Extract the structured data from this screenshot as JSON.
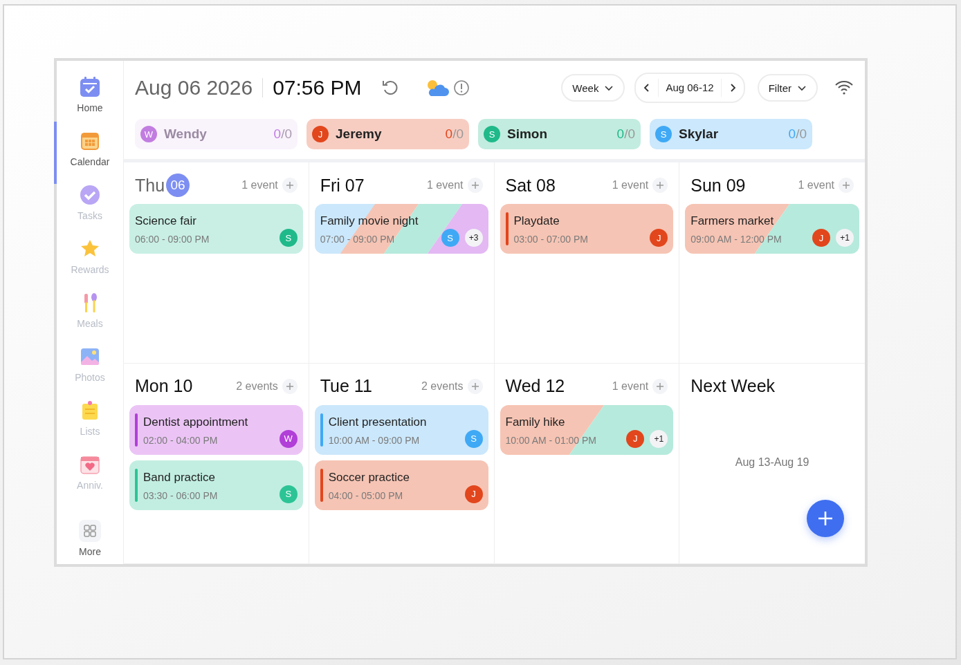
{
  "sidebar": {
    "items": [
      {
        "label": "Home",
        "selected": false,
        "dimmed": false
      },
      {
        "label": "Calendar",
        "selected": true,
        "dimmed": false
      },
      {
        "label": "Tasks",
        "selected": false,
        "dimmed": true
      },
      {
        "label": "Rewards",
        "selected": false,
        "dimmed": true
      },
      {
        "label": "Meals",
        "selected": false,
        "dimmed": true
      },
      {
        "label": "Photos",
        "selected": false,
        "dimmed": true
      },
      {
        "label": "Lists",
        "selected": false,
        "dimmed": true
      },
      {
        "label": "Anniv.",
        "selected": false,
        "dimmed": true
      },
      {
        "label": "More",
        "selected": false,
        "dimmed": false
      }
    ]
  },
  "header": {
    "date": "Aug 06 2026",
    "time": "07:56 PM",
    "view": "Week",
    "range": "Aug 06-12",
    "filter": "Filter"
  },
  "members": [
    {
      "name": "Wendy",
      "initial": "W",
      "color": "#c17de0",
      "done": "0",
      "rest": "/0",
      "selected": false
    },
    {
      "name": "Jeremy",
      "initial": "J",
      "color": "#e2461c",
      "done": "0",
      "rest": "/0",
      "selected": true
    },
    {
      "name": "Simon",
      "initial": "S",
      "color": "#1fb98a",
      "done": "0",
      "rest": "/0",
      "selected": true
    },
    {
      "name": "Skylar",
      "initial": "S",
      "color": "#3fa9f5",
      "done": "0",
      "rest": "/0",
      "selected": true
    }
  ],
  "days": [
    {
      "kind": "day",
      "weekday": "Thu",
      "date": "06",
      "today": true,
      "count": "1 event",
      "events": [
        {
          "title": "Science fair",
          "time": "06:00 - 09:00 PM",
          "color": "#c9efe4",
          "accent": false,
          "avatar": {
            "initial": "S",
            "color": "#1fb98a"
          }
        }
      ]
    },
    {
      "kind": "day",
      "weekday": "Fri",
      "date": "07",
      "today": false,
      "count": "1 event",
      "events": [
        {
          "title": "Family movie night",
          "time": "07:00 - 09:00 PM",
          "accent": false,
          "stripes": [
            {
              "color": "#cbe7fb"
            },
            {
              "color": "#f6c4b4"
            },
            {
              "color": "#b6eadc"
            },
            {
              "color": "#e3b8f3"
            }
          ],
          "avatar": {
            "initial": "S",
            "color": "#3fa9f5"
          },
          "more": "+3"
        }
      ]
    },
    {
      "kind": "day",
      "weekday": "Sat",
      "date": "08",
      "today": false,
      "count": "1 event",
      "events": [
        {
          "title": "Playdate",
          "time": "03:00 - 07:00 PM",
          "color": "#f6c4b4",
          "accent": true,
          "avatar": {
            "initial": "J",
            "color": "#e2461c"
          }
        }
      ]
    },
    {
      "kind": "day",
      "weekday": "Sun",
      "date": "09",
      "today": false,
      "count": "1 event",
      "events": [
        {
          "title": "Farmers market",
          "time": "09:00 AM - 12:00 PM",
          "accent": false,
          "stripes": [
            {
              "color": "#f6c4b4"
            },
            {
              "color": "#b6eadc"
            }
          ],
          "avatar": {
            "initial": "J",
            "color": "#e2461c"
          },
          "more": "+1"
        }
      ]
    },
    {
      "kind": "day",
      "weekday": "Mon",
      "date": "10",
      "today": false,
      "count": "2 events",
      "events": [
        {
          "title": "Dentist appointment",
          "time": "02:00 - 04:00 PM",
          "color": "#ebc4f5",
          "accent": true,
          "avatar": {
            "initial": "W",
            "color": "#b13fd8"
          }
        },
        {
          "title": "Band practice",
          "time": "03:30 - 06:00 PM",
          "color": "#c2eee1",
          "accent": true,
          "avatar": {
            "initial": "S",
            "color": "#2cc495"
          }
        }
      ]
    },
    {
      "kind": "day",
      "weekday": "Tue",
      "date": "11",
      "today": false,
      "count": "2 events",
      "events": [
        {
          "title": "Client presentation",
          "time": "10:00 AM - 09:00 PM",
          "color": "#cbe7fb",
          "accent": true,
          "avatar": {
            "initial": "S",
            "color": "#3fa9f5"
          }
        },
        {
          "title": "Soccer practice",
          "time": "04:00 - 05:00 PM",
          "color": "#f6c4b4",
          "accent": true,
          "avatar": {
            "initial": "J",
            "color": "#e2461c"
          }
        }
      ]
    },
    {
      "kind": "day",
      "weekday": "Wed",
      "date": "12",
      "today": false,
      "count": "1 event",
      "events": [
        {
          "title": "Family hike",
          "time": "10:00 AM - 01:00 PM",
          "accent": false,
          "stripes": [
            {
              "color": "#f6c4b4"
            },
            {
              "color": "#b6eadc"
            }
          ],
          "avatar": {
            "initial": "J",
            "color": "#e2461c"
          },
          "more": "+1"
        }
      ]
    },
    {
      "kind": "next_week",
      "title": "Next Week",
      "range": "Aug 13-Aug 19"
    }
  ]
}
